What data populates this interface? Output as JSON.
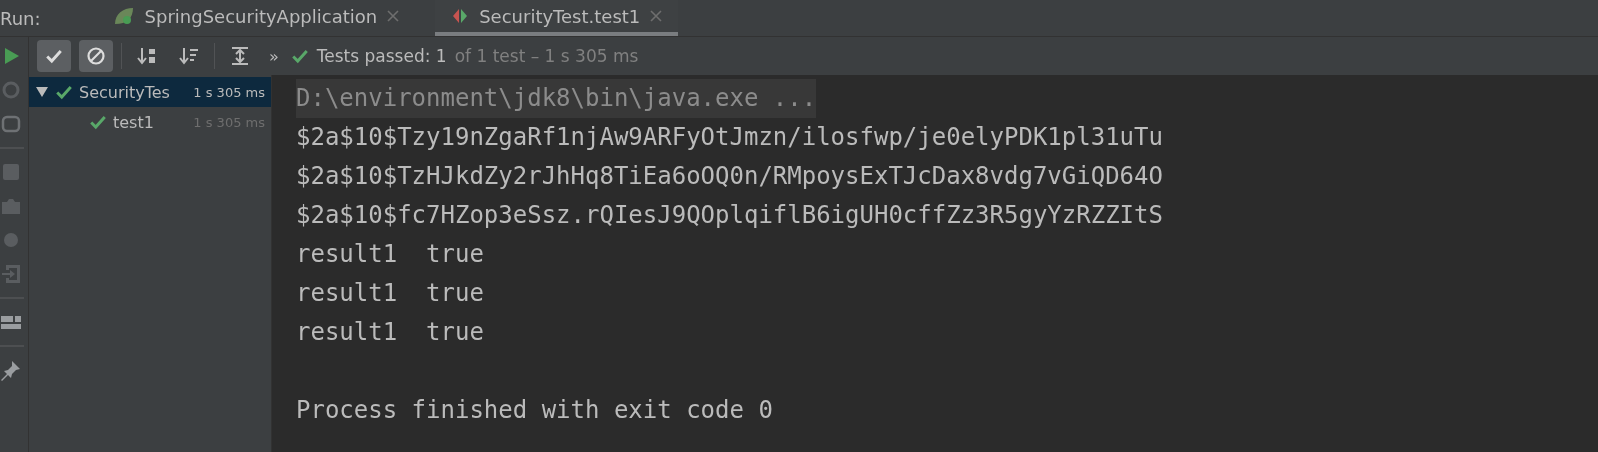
{
  "run_label": "Run:",
  "tabs": [
    {
      "label": "SpringSecurityApplication",
      "kind": "app",
      "selected": false
    },
    {
      "label": "SecurityTest.test1",
      "kind": "test",
      "selected": true
    }
  ],
  "toolbar": {
    "show_passed": {
      "selected": true
    },
    "show_ignored": {
      "selected": true
    },
    "more": "»"
  },
  "status": {
    "passed": "Tests passed: 1",
    "detail": "of 1 test – 1 s 305 ms"
  },
  "tree": [
    {
      "label": "SecurityTes",
      "time": "1 s 305 ms",
      "selected": true,
      "expanded": true,
      "children": [
        {
          "label": "test1",
          "time": "1 s 305 ms",
          "selected": false
        }
      ]
    }
  ],
  "console": [
    {
      "kind": "command",
      "text": "D:\\environment\\jdk8\\bin\\java.exe ..."
    },
    {
      "kind": "output",
      "text": "$2a$10$Tzy19nZgaRf1njAw9ARFyOtJmzn/ilosfwp/je0elyPDK1pl31uTu"
    },
    {
      "kind": "output",
      "text": "$2a$10$TzHJkdZy2rJhHq8TiEa6oOQ0n/RMpoysExTJcDax8vdg7vGiQD64O"
    },
    {
      "kind": "output",
      "text": "$2a$10$fc7HZop3eSsz.rQIesJ9QOplqiflB6igUH0cffZz3R5gyYzRZZItS"
    },
    {
      "kind": "output",
      "text": "result1  true"
    },
    {
      "kind": "output",
      "text": "result1  true"
    },
    {
      "kind": "output",
      "text": "result1  true"
    },
    {
      "kind": "exit",
      "text": "Process finished with exit code 0"
    }
  ]
}
